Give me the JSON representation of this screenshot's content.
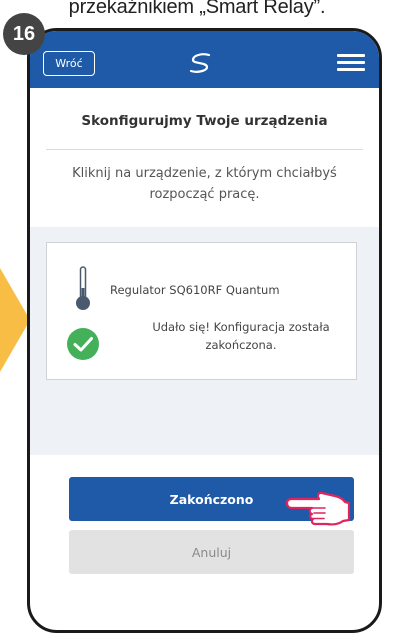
{
  "caption": "przekaźnikiem „Smart Relay”.",
  "step_number": "16",
  "topbar": {
    "back_label": "Wróć",
    "background": "#1e5aa8"
  },
  "page": {
    "title": "Skonfigurujmy Twoje urządzenia",
    "instruction": "Kliknij na urządzenie, z którym chciałbyś rozpocząć pracę."
  },
  "device": {
    "name": "Regulator SQ610RF Quantum",
    "status": "Udało się! Konfiguracja została zakończona.",
    "status_color": "#45b05a"
  },
  "actions": {
    "done_label": "Zakończono",
    "cancel_label": "Anuluj"
  },
  "icons": [
    "hamburger-icon",
    "salus-logo-icon",
    "thermometer-icon",
    "check-circle-icon",
    "pointing-hand-icon",
    "arrow-indicator"
  ]
}
